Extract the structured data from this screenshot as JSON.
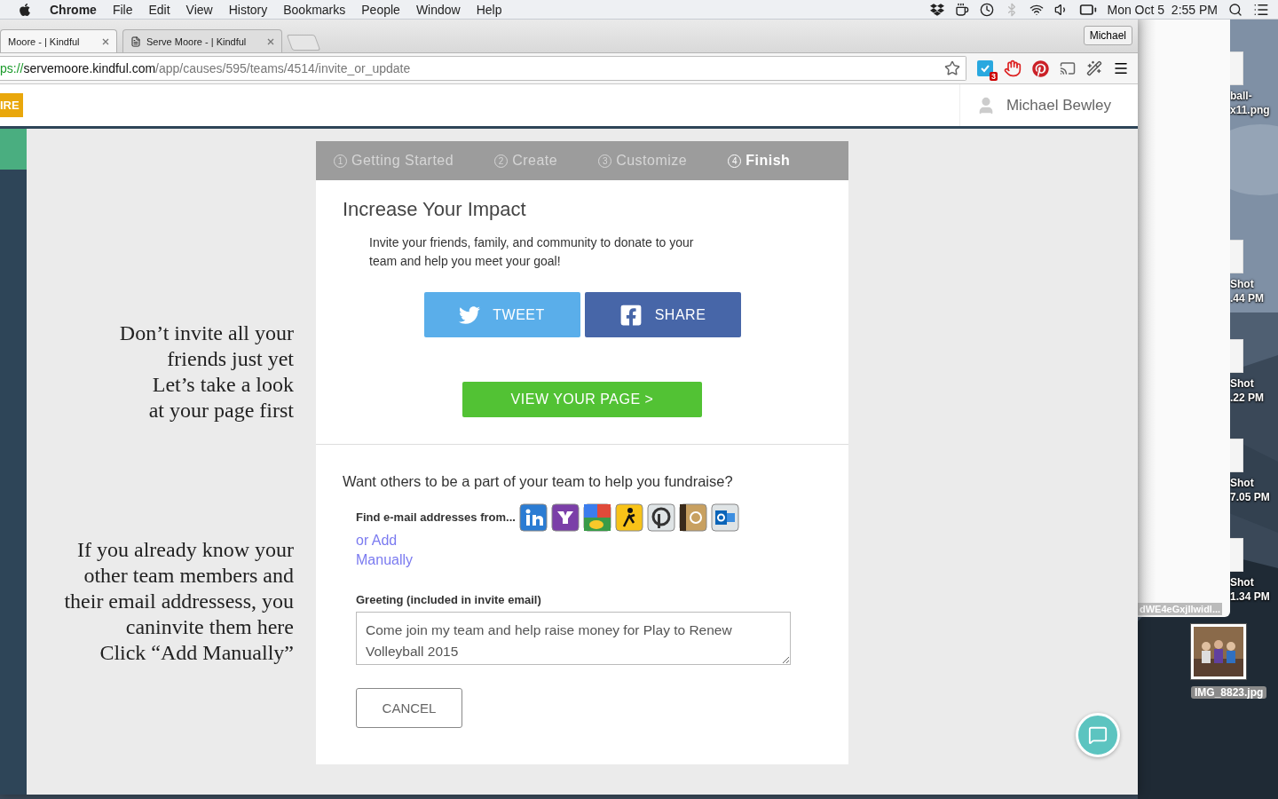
{
  "menubar": {
    "app": "Chrome",
    "menus": [
      "File",
      "Edit",
      "View",
      "History",
      "Bookmarks",
      "People",
      "Window",
      "Help"
    ],
    "clock": "Mon Oct 5  2:55 PM"
  },
  "browser": {
    "tabs": [
      {
        "title": "Moore - | Kindful",
        "selected": true
      },
      {
        "title": "Serve Moore - | Kindful",
        "selected": false
      }
    ],
    "profile": "Michael",
    "url": {
      "scheme": "ps://",
      "host": "servemoore.kindful.com",
      "path": "/app/causes/595/teams/4514/invite_or_update"
    },
    "extension_badge": "3"
  },
  "site": {
    "logo": "IRE",
    "user": "Michael Bewley"
  },
  "notes": [
    "Don’t invite all your\nfriends just yet\nLet’s take a look\nat your page first",
    "If you already know your\nother team members and\ntheir email addressess, you\ncaninvite them here\nClick “Add Manually”"
  ],
  "steps": [
    {
      "number": "1",
      "label": "Getting Started",
      "selected": false
    },
    {
      "number": "2",
      "label": "Create",
      "selected": false
    },
    {
      "number": "3",
      "label": "Customize",
      "selected": false
    },
    {
      "number": "4",
      "label": "Finish",
      "selected": true
    }
  ],
  "impact": {
    "title": "Increase Your Impact",
    "text": "Invite your friends, family, and community to donate to your team and help you meet your goal!",
    "tweet": "TWEET",
    "share": "SHARE",
    "view": "VIEW YOUR PAGE >"
  },
  "team": {
    "question": "Want others to be a part of your team to help you fundraise?",
    "find_label": "Find e-mail addresses from...",
    "add_link": "or Add Manually",
    "greeting_label": "Greeting (included in invite email)",
    "greeting_value": "Come join my team and help raise money for Play to Renew Volleyball 2015",
    "cancel": "CANCEL"
  },
  "desktop": {
    "icons": [
      {
        "label": "ball-\nx11.png",
        "kind": "document"
      },
      {
        "label": "Shot\n.44 PM",
        "kind": "document"
      },
      {
        "label": "Shot\n.22 PM",
        "kind": "document"
      },
      {
        "label": "Shot\n7.05 PM",
        "kind": "document"
      },
      {
        "label": "Shot\n1.34 PM",
        "kind": "document"
      },
      {
        "label": "IMG_8823.jpg"
      }
    ],
    "window_label": "dWE4eGxjIlwidl..."
  }
}
